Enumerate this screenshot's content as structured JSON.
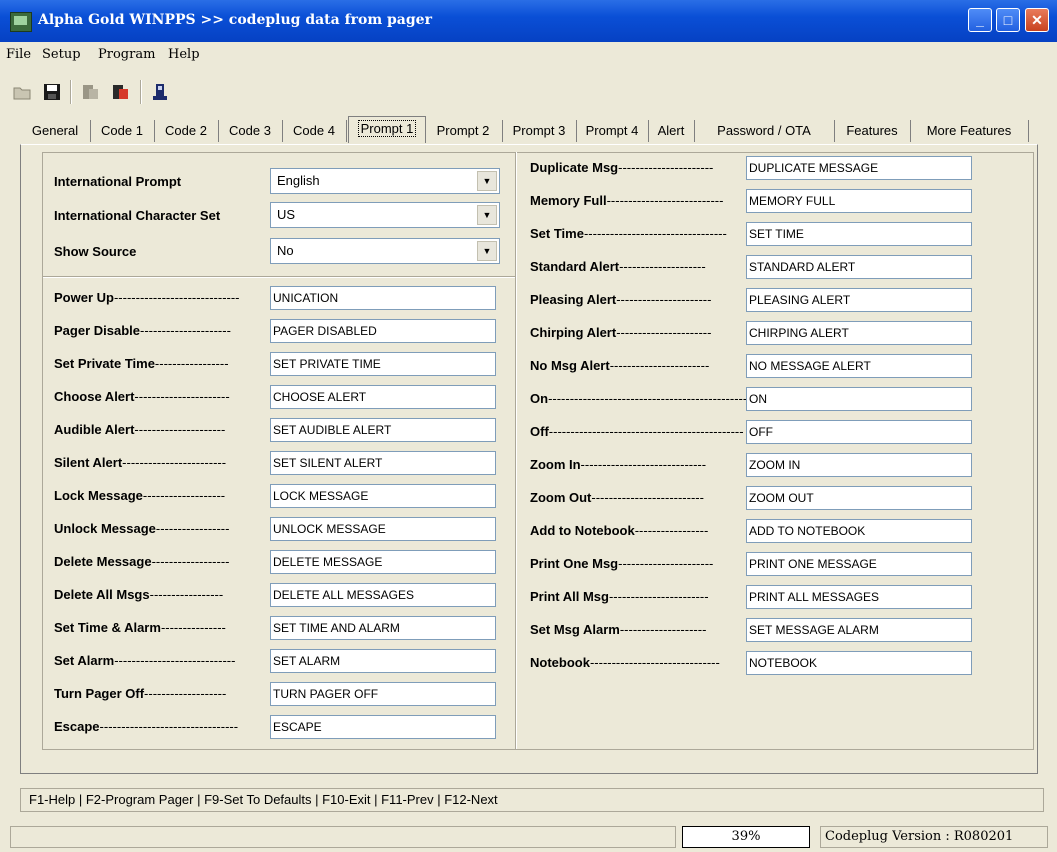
{
  "window": {
    "title": "Alpha Gold WINPPS >> codeplug data from pager",
    "minimize": "_",
    "maximize": "□",
    "close": "✕"
  },
  "menu": [
    "File",
    "Setup",
    "Program",
    "Help"
  ],
  "toolbar": [
    "open-icon",
    "save-icon",
    "read-pager-icon",
    "write-pager-icon",
    "pager-icon"
  ],
  "tabs": [
    "General",
    "Code 1",
    "Code 2",
    "Code 3",
    "Code 4",
    "Prompt 1",
    "Prompt 2",
    "Prompt 3",
    "Prompt 4",
    "Alert",
    "Password / OTA",
    "Features",
    "More Features"
  ],
  "active_tab": "Prompt 1",
  "settings": [
    {
      "label": "International Prompt",
      "value": "English"
    },
    {
      "label": "International Character Set",
      "value": "US"
    },
    {
      "label": "Show Source",
      "value": "No"
    }
  ],
  "left_prompts": [
    {
      "label": "Power Up",
      "dashes": "-----------------------------",
      "value": "UNICATION"
    },
    {
      "label": "Pager Disable",
      "dashes": "---------------------",
      "value": "PAGER DISABLED"
    },
    {
      "label": "Set Private Time",
      "dashes": "-----------------",
      "value": "SET PRIVATE TIME"
    },
    {
      "label": "Choose Alert",
      "dashes": "----------------------",
      "value": "CHOOSE ALERT"
    },
    {
      "label": "Audible Alert",
      "dashes": "---------------------",
      "value": "SET AUDIBLE ALERT"
    },
    {
      "label": "Silent Alert",
      "dashes": "------------------------",
      "value": "SET SILENT ALERT"
    },
    {
      "label": "Lock Message",
      "dashes": "-------------------",
      "value": "LOCK MESSAGE"
    },
    {
      "label": "Unlock Message",
      "dashes": "-----------------",
      "value": "UNLOCK MESSAGE"
    },
    {
      "label": "Delete Message",
      "dashes": "------------------",
      "value": "DELETE MESSAGE"
    },
    {
      "label": "Delete All Msgs",
      "dashes": "-----------------",
      "value": "DELETE ALL MESSAGES"
    },
    {
      "label": "Set Time & Alarm",
      "dashes": "---------------",
      "value": "SET TIME AND ALARM"
    },
    {
      "label": "Set Alarm",
      "dashes": "----------------------------",
      "value": "SET ALARM"
    },
    {
      "label": "Turn Pager Off",
      "dashes": "-------------------",
      "value": "TURN PAGER OFF"
    },
    {
      "label": "Escape",
      "dashes": "--------------------------------",
      "value": "ESCAPE"
    }
  ],
  "right_prompts": [
    {
      "label": "Duplicate Msg",
      "dashes": "----------------------",
      "value": "DUPLICATE MESSAGE"
    },
    {
      "label": "Memory Full",
      "dashes": "---------------------------",
      "value": "MEMORY FULL"
    },
    {
      "label": "Set Time",
      "dashes": "---------------------------------",
      "value": "SET TIME"
    },
    {
      "label": "Standard Alert",
      "dashes": "--------------------",
      "value": "STANDARD ALERT"
    },
    {
      "label": "Pleasing Alert",
      "dashes": "----------------------",
      "value": "PLEASING ALERT"
    },
    {
      "label": "Chirping Alert",
      "dashes": "----------------------",
      "value": "CHIRPING ALERT"
    },
    {
      "label": "No Msg Alert",
      "dashes": "-----------------------",
      "value": "NO MESSAGE ALERT"
    },
    {
      "label": "On",
      "dashes": "----------------------------------------------",
      "value": "ON"
    },
    {
      "label": "Off",
      "dashes": "---------------------------------------------",
      "value": "OFF"
    },
    {
      "label": "Zoom In",
      "dashes": "-----------------------------",
      "value": "ZOOM IN"
    },
    {
      "label": "Zoom Out",
      "dashes": "--------------------------",
      "value": "ZOOM OUT"
    },
    {
      "label": "Add to Notebook",
      "dashes": "-----------------",
      "value": "ADD TO NOTEBOOK"
    },
    {
      "label": "Print One Msg",
      "dashes": "----------------------",
      "value": "PRINT ONE MESSAGE"
    },
    {
      "label": "Print All Msg",
      "dashes": "-----------------------",
      "value": "PRINT ALL MESSAGES"
    },
    {
      "label": "Set Msg Alarm",
      "dashes": "--------------------",
      "value": "SET MESSAGE ALARM"
    },
    {
      "label": "Notebook",
      "dashes": "------------------------------",
      "value": "NOTEBOOK"
    }
  ],
  "hotkeys": "F1-Help | F2-Program Pager | F9-Set To Defaults | F10-Exit | F11-Prev | F12-Next",
  "progress": {
    "percent": 39,
    "label": "39%"
  },
  "version": "Codeplug Version : R080201"
}
